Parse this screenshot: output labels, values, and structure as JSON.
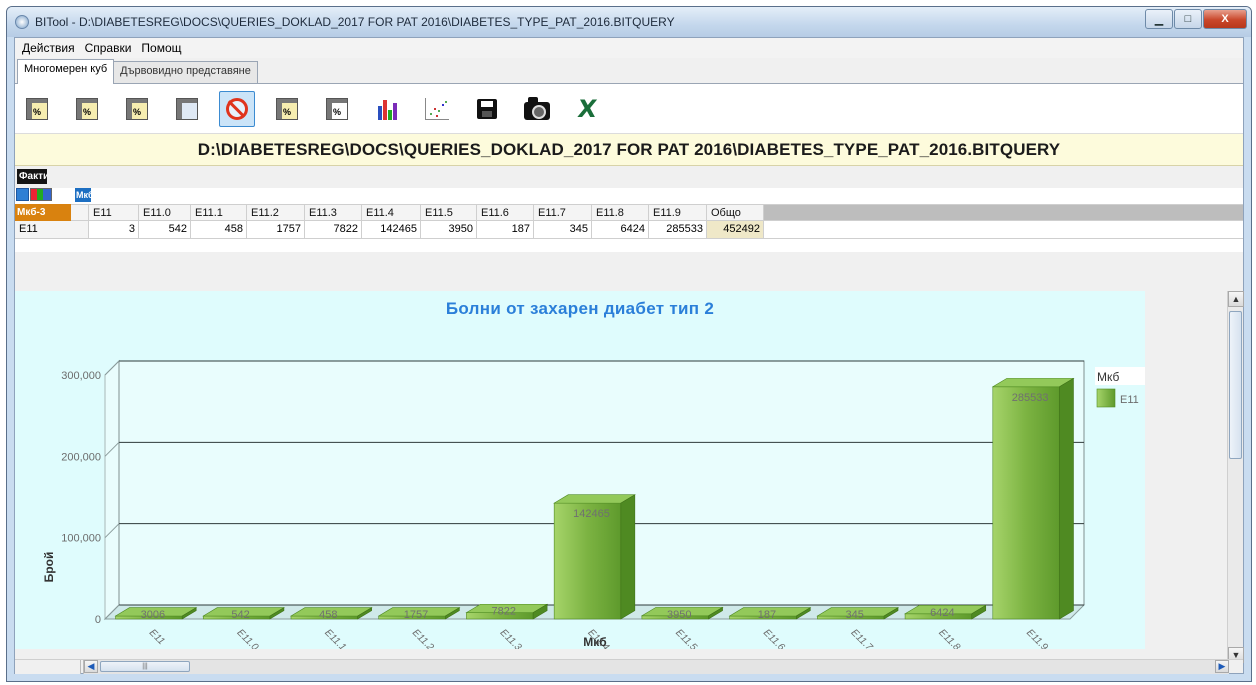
{
  "window": {
    "title": "BITool - D:\\DIABETESREG\\DOCS\\QUERIES_DOKLAD_2017 FOR PAT 2016\\DIABETES_TYPE_PAT_2016.BITQUERY",
    "min_label": "▁",
    "max_label": "□",
    "close_label": "X"
  },
  "menu": {
    "items": [
      "Действия",
      "Справки",
      "Помощ"
    ]
  },
  "tabs": [
    {
      "label": "Многомерен куб",
      "active": true
    },
    {
      "label": "Дървовидно представяне",
      "active": false
    }
  ],
  "toolbar": {
    "buttons": [
      {
        "icon": "percent-grid-icon",
        "glyph": "%"
      },
      {
        "icon": "percent-row-icon",
        "glyph": "%"
      },
      {
        "icon": "percent-column-icon",
        "glyph": "%"
      },
      {
        "icon": "grid-edit-icon",
        "glyph": ""
      },
      {
        "icon": "no-filter-icon",
        "glyph": "",
        "selected": true
      },
      {
        "icon": "grid-percent-icon",
        "glyph": "%"
      },
      {
        "icon": "grid-percent-alt-icon",
        "glyph": "%"
      },
      {
        "icon": "bar-chart-icon",
        "glyph": ""
      },
      {
        "icon": "scatter-chart-icon",
        "glyph": ""
      },
      {
        "icon": "save-disk-icon",
        "glyph": ""
      },
      {
        "icon": "camera-icon",
        "glyph": ""
      },
      {
        "icon": "excel-export-icon",
        "glyph": "X"
      }
    ]
  },
  "path_banner": "D:\\DIABETESREG\\DOCS\\QUERIES_DOKLAD_2017 FOR PAT 2016\\DIABETES_TYPE_PAT_2016.BITQUERY",
  "pivot": {
    "facts_label": "Факти",
    "column_field": "Мкб",
    "row_field": "Мкб-3",
    "header": [
      "E11",
      "E11.0",
      "E11.1",
      "E11.2",
      "E11.3",
      "E11.4",
      "E11.5",
      "E11.6",
      "E11.7",
      "E11.8",
      "E11.9",
      "Общо"
    ],
    "row_label": "E11",
    "row_values": [
      "3",
      "542",
      "458",
      "1757",
      "7822",
      "142465",
      "3950",
      "187",
      "345",
      "6424",
      "285533",
      "452492"
    ]
  },
  "chart_data": {
    "type": "bar",
    "title": "Болни от захарен диабет тип 2",
    "xlabel": "Мкб",
    "ylabel": "Брой",
    "legend_title": "Мкб",
    "legend_position": "top-right",
    "series": [
      {
        "name": "E11",
        "color": "#6fae3a",
        "values": [
          3006,
          542,
          458,
          1757,
          7822,
          142465,
          3950,
          187,
          345,
          6424,
          285533
        ],
        "data_labels": [
          "3006",
          "542",
          "458",
          "1757",
          "7822",
          "142465",
          "3950",
          "187",
          "345",
          "6424",
          "285533"
        ]
      }
    ],
    "categories": [
      "E11",
      "E11.0",
      "E11.1",
      "E11.2",
      "E11.3",
      "E11.4",
      "E11.5",
      "E11.6",
      "E11.7",
      "E11.8",
      "E11.9"
    ],
    "ylim": [
      0,
      300000
    ],
    "yticks": [
      0,
      100000,
      200000,
      300000
    ],
    "ytick_labels": [
      "0",
      "100,000",
      "200,000",
      "300,000"
    ],
    "grid": true
  }
}
